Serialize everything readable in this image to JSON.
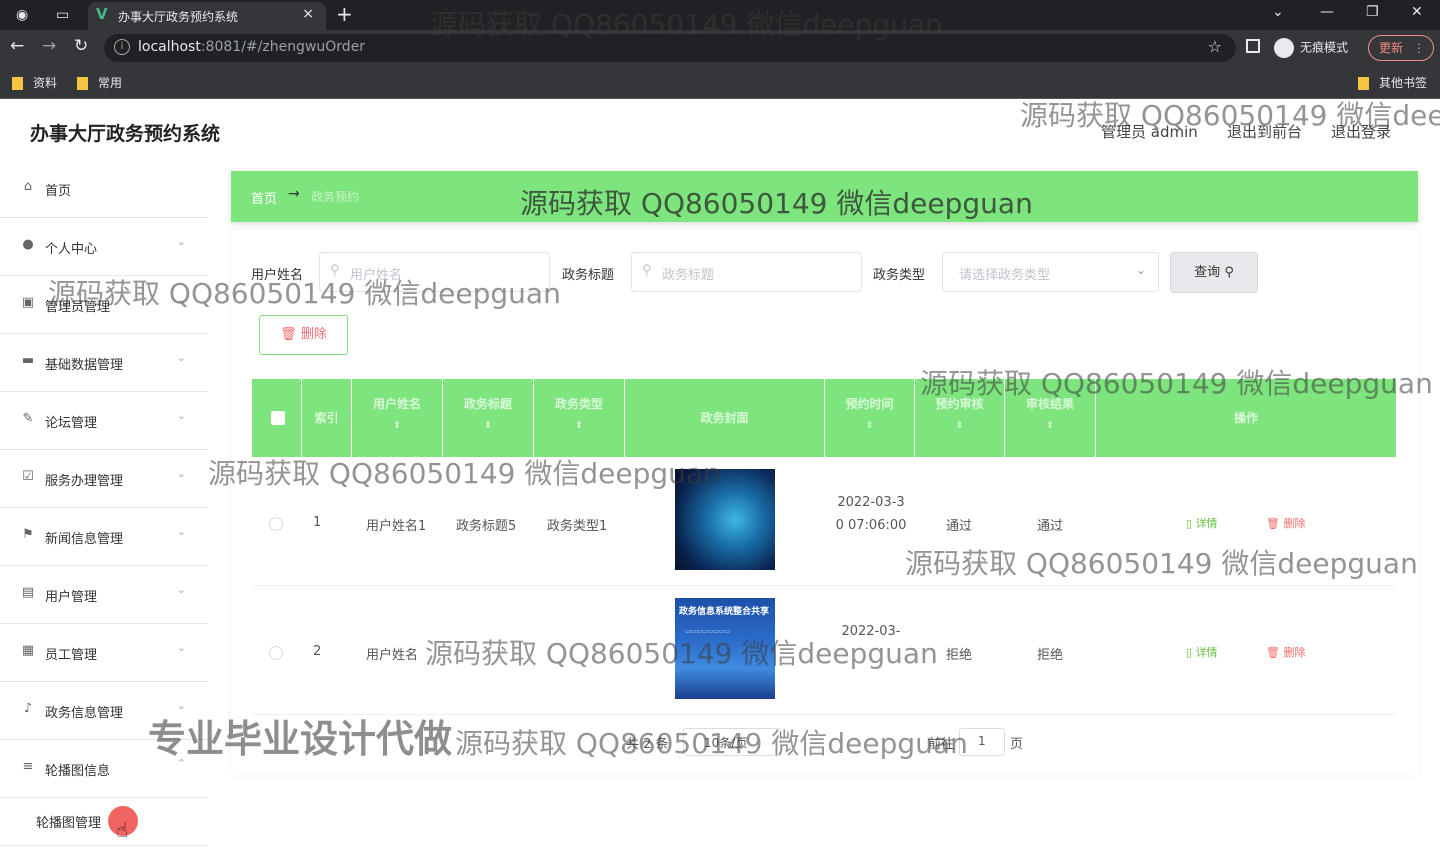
{
  "browser": {
    "tab_title": "办事大厅政务预约系统",
    "url_host": "localhost",
    "url_rest": ":8081/#/zhengwuOrder",
    "incognito_label": "无痕模式",
    "update_label": "更新",
    "bookmarks": [
      "资料",
      "常用"
    ],
    "other_bookmarks": "其他书签"
  },
  "header": {
    "brand": "办事大厅政务预约系统",
    "admin_label": "管理员 admin",
    "to_front": "退出到前台",
    "logout": "退出登录"
  },
  "sidebar": {
    "items": [
      {
        "label": "首页",
        "icon": "home-icon"
      },
      {
        "label": "个人中心",
        "icon": "user-icon"
      },
      {
        "label": "管理员管理",
        "icon": "admin-icon"
      },
      {
        "label": "基础数据管理",
        "icon": "monitor-icon"
      },
      {
        "label": "论坛管理",
        "icon": "forum-icon"
      },
      {
        "label": "服务办理管理",
        "icon": "check-icon"
      },
      {
        "label": "新闻信息管理",
        "icon": "flag-icon"
      },
      {
        "label": "用户管理",
        "icon": "doc-icon"
      },
      {
        "label": "员工管理",
        "icon": "grid-icon"
      },
      {
        "label": "政务信息管理",
        "icon": "mic-icon"
      },
      {
        "label": "轮播图信息",
        "icon": "tray-icon"
      }
    ],
    "sub_item": "轮播图管理"
  },
  "breadcrumb": {
    "home": "首页",
    "current": "政务预约"
  },
  "filters": {
    "user_label": "用户姓名",
    "user_placeholder": "用户姓名",
    "title_label": "政务标题",
    "title_placeholder": "政务标题",
    "type_label": "政务类型",
    "type_placeholder": "请选择政务类型",
    "query_label": "查询"
  },
  "toolbar": {
    "delete_label": "删除"
  },
  "table": {
    "headers": [
      "索引",
      "用户姓名",
      "政务标题",
      "政务类型",
      "政务封面",
      "预约时间",
      "预约审核",
      "审核结果",
      "操作"
    ],
    "rows": [
      {
        "index": "1",
        "user": "用户姓名1",
        "title": "政务标题5",
        "type": "政务类型1",
        "time": "2022-03-30 07:06:00",
        "audit": "通过",
        "result": "通过"
      },
      {
        "index": "2",
        "user": "用户姓名",
        "title": "",
        "type": "",
        "time": "2022-03-",
        "audit": "拒绝",
        "result": "拒绝"
      }
    ],
    "thumb2_title": "政务信息系统整合共享",
    "detail_label": "详情",
    "delete_label": "删除"
  },
  "pagination": {
    "total_prefix": "共 2 条",
    "page_size": "10条/页",
    "goto": "前往",
    "page_num": "1",
    "page_suffix": "页"
  },
  "watermarks": {
    "text": "源码获取 QQ86050149 微信deepguan",
    "big": "专业毕业设计代做"
  }
}
